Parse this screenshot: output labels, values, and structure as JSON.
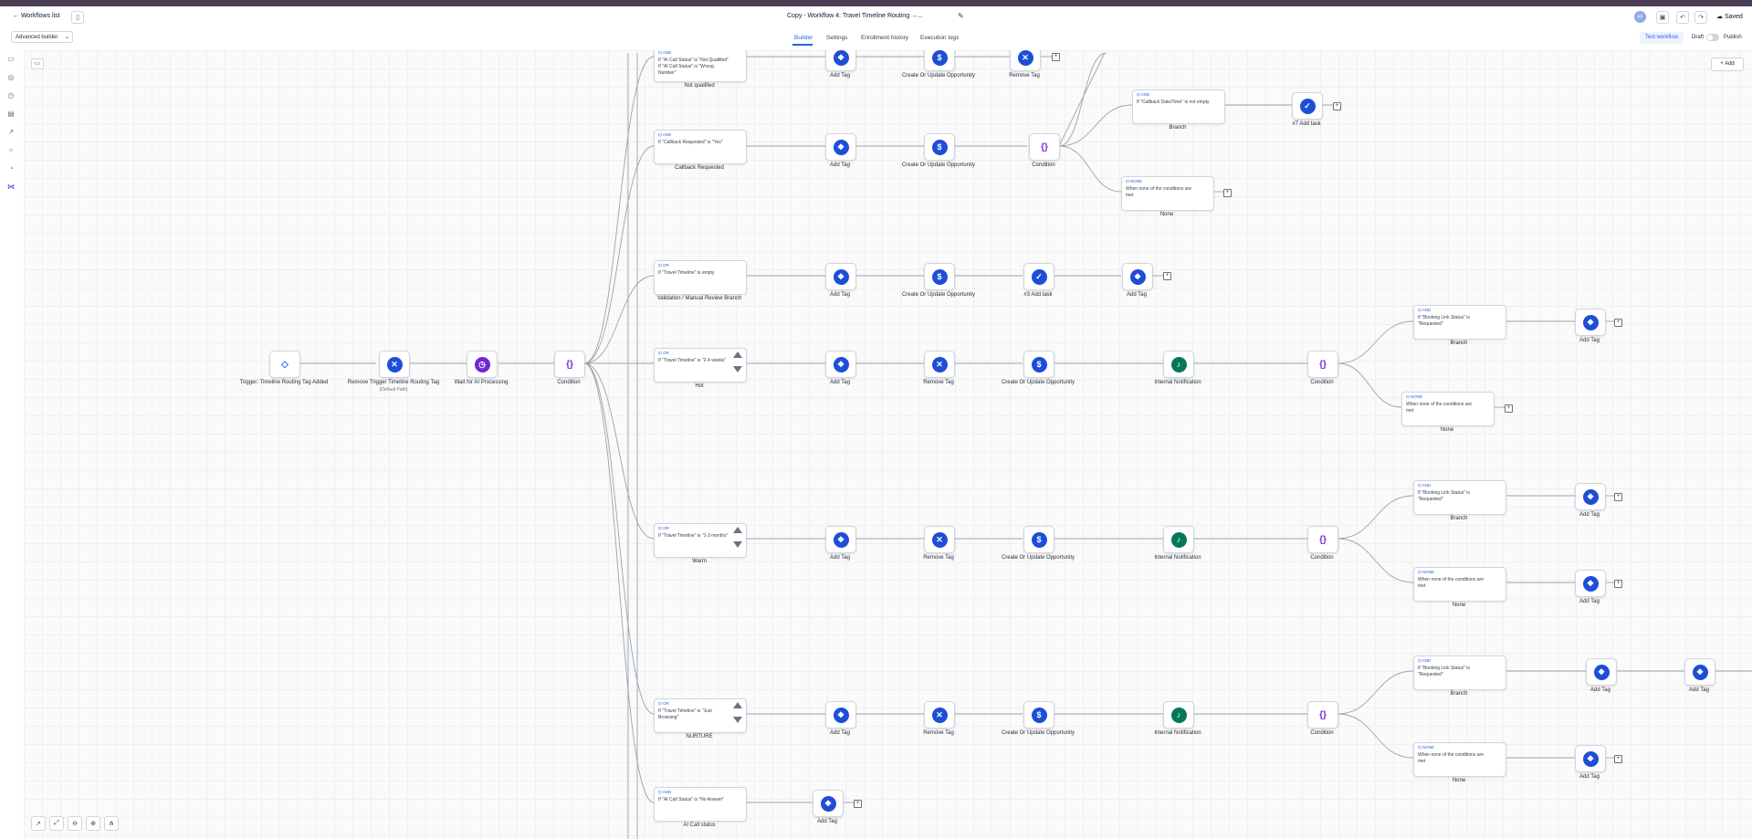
{
  "header": {
    "back_label": "Workflows list",
    "title": "Copy - Workflow 4: Travel Timeline Routing →...",
    "avatar_initials": "AF",
    "saved_label": "Saved"
  },
  "subnav": {
    "builder_select": "Advanced builder",
    "tabs": [
      "Builder",
      "Settings",
      "Enrollment history",
      "Execution logs"
    ],
    "test_label": "Test workflow",
    "draft_label": "Draft",
    "publish_label": "Publish"
  },
  "canvas": {
    "add_label": "Add"
  },
  "nodes": [
    {
      "label": "Trigger: Timeline Routing Tag Added",
      "icon": "tag-outline-icon"
    },
    {
      "label": "Remove Trigger Timeline Routing Tag",
      "sub": "(Default Path)",
      "icon": "remove-tag-icon"
    },
    {
      "label": "Wait for AI Processing",
      "icon": "clock-icon"
    },
    {
      "label": "Condition",
      "icon": "condition-braces-icon"
    },
    {
      "label": "Not qualified"
    },
    {
      "label": "Add Tag",
      "icon": "tag-icon"
    },
    {
      "label": "Create Or Update Opportunity",
      "icon": "dollar-icon"
    },
    {
      "label": "Remove Tag",
      "icon": "remove-tag-icon"
    },
    {
      "label": "Callback Requested"
    },
    {
      "label": "Condition"
    },
    {
      "label": "Branch"
    },
    {
      "label": "#7 Add task",
      "icon": "task-icon"
    },
    {
      "label": "None"
    },
    {
      "label": "Validation / Manual Review Branch"
    },
    {
      "label": "#3 Add task"
    },
    {
      "label": "Hot"
    },
    {
      "label": "Internal Notification",
      "icon": "bell-icon"
    },
    {
      "label": "Warm"
    },
    {
      "label": "NURTURE"
    },
    {
      "label": "AI Call status"
    }
  ],
  "cards": {
    "not_qualified": {
      "tag": "AND",
      "cond": "If \"AI Call Status\" is \"Not Qualified\" If \"AI Call Status\" is \"Wrong Number\""
    },
    "callback": {
      "tag": "AND",
      "cond": "If \"Callback Requested\" is \"Yes\""
    },
    "callback_branch": {
      "tag": "AND",
      "cond": "If \"Callback Date/Time\" is not empty"
    },
    "none_text": {
      "tag": "NONE",
      "cond": "When none of the conditions are met"
    },
    "validation": {
      "tag": "OR",
      "cond": "If \"Travel Timeline\" is empty"
    },
    "hot": {
      "tag": "OR",
      "cond": "If \"Travel Timeline\" is \"2-4 weeks\""
    },
    "booking": {
      "tag": "AND",
      "cond": "If \"Booking Link Status\" is \"Requested\""
    },
    "warm": {
      "tag": "OR",
      "cond": "If \"Travel Timeline\" is \"1-3 months\""
    },
    "nurture": {
      "tag": "OR",
      "cond": "If \"Travel Timeline\" is \"Just Browsing\""
    },
    "ai_call": {
      "tag": "AND",
      "cond": "If \"AI Call Status\" is \"No Answer\""
    }
  }
}
